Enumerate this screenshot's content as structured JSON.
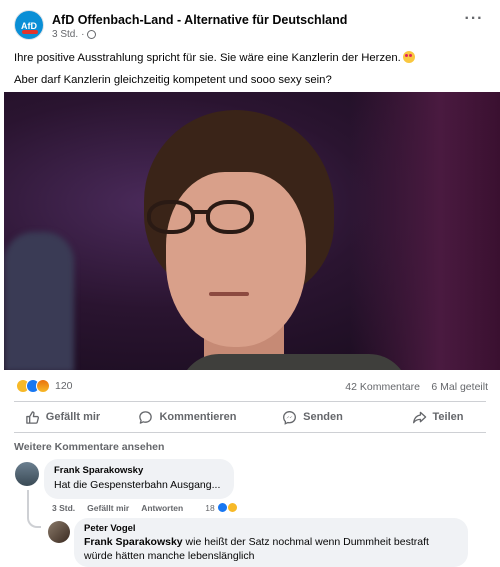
{
  "post": {
    "page_name": "AfD Offenbach-Land - Alternative für Deutschland",
    "avatar_text": "AfD",
    "time": "3 Std.",
    "separator": "·",
    "more_label": "···",
    "text_line1": "Ihre positive Ausstrahlung spricht für sie. Sie wäre eine Kanzlerin der Herzen.",
    "text_line2": "Aber darf Kanzlerin gleichzeitig kompetent und sooo sexy sein?"
  },
  "stats": {
    "reaction_count": "120",
    "comments": "42 Kommentare",
    "shares": "6 Mal geteilt"
  },
  "actions": {
    "like": "Gefällt mir",
    "comment": "Kommentieren",
    "send": "Senden",
    "share": "Teilen"
  },
  "comments": {
    "more_label": "Weitere Kommentare ansehen",
    "items": [
      {
        "author": "Frank Sparakowsky",
        "text": "Hat die Gespensterbahn Ausgang...",
        "time": "3 Std.",
        "like_label": "Gefällt mir",
        "reply_label": "Antworten",
        "reaction_count": "18"
      },
      {
        "author": "Peter Vogel",
        "mention": "Frank Sparakowsky",
        "text": " wie heißt der Satz nochmal wenn Dummheit bestraft würde hätten manche lebenslänglich"
      }
    ]
  },
  "colors": {
    "accent_blue": "#1877f2",
    "meta_gray": "#65676b",
    "bubble_bg": "#f0f2f5"
  }
}
